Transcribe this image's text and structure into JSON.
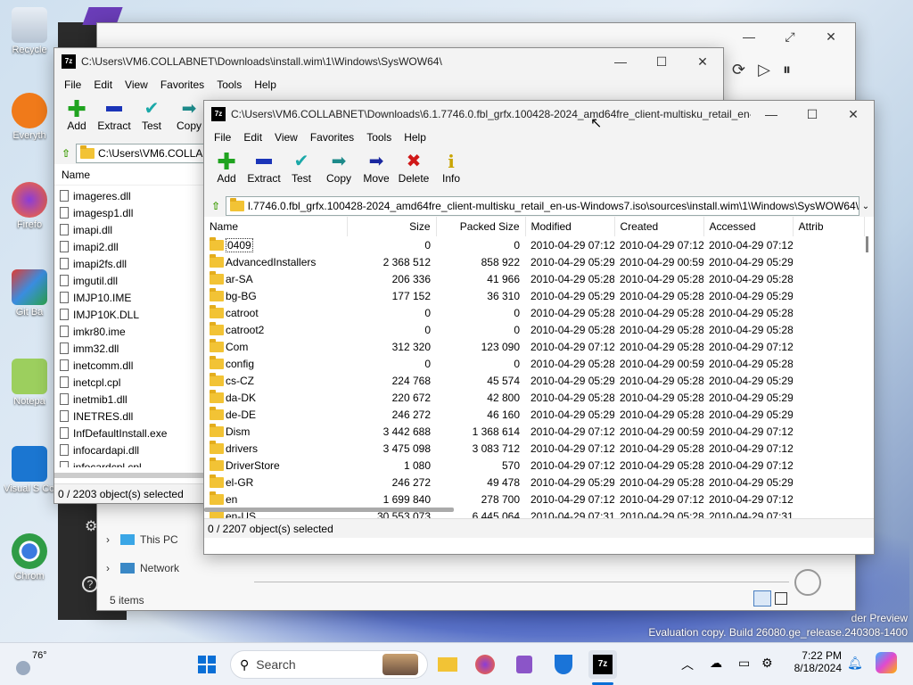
{
  "desktop": {
    "icons": [
      {
        "label": "Recycle"
      },
      {
        "label": "Everyth"
      },
      {
        "label": "Firefo"
      },
      {
        "label": "Git Ba"
      },
      {
        "label": "Notepa"
      },
      {
        "label": "Visual S Cod"
      },
      {
        "label": "Chrom"
      }
    ],
    "watermark_line1": "der Preview",
    "watermark_line2": "Evaluation copy. Build 26080.ge_release.240308-1400"
  },
  "explorer": {
    "nav": [
      {
        "label": "This PC"
      },
      {
        "label": "Network"
      }
    ],
    "status": "5 items"
  },
  "back_window": {
    "title": "C:\\Users\\VM6.COLLABNET\\Downloads\\install.wim\\1\\Windows\\SysWOW64\\",
    "menu": [
      "File",
      "Edit",
      "View",
      "Favorites",
      "Tools",
      "Help"
    ],
    "toolbar": [
      "Add",
      "Extract",
      "Test",
      "Copy"
    ],
    "address": "C:\\Users\\VM6.COLLA",
    "column_name": "Name",
    "files": [
      "imageres.dll",
      "imagesp1.dll",
      "imapi.dll",
      "imapi2.dll",
      "imapi2fs.dll",
      "imgutil.dll",
      "IMJP10.IME",
      "IMJP10K.DLL",
      "imkr80.ime",
      "imm32.dll",
      "inetcomm.dll",
      "inetcpl.cpl",
      "inetmib1.dll",
      "INETRES.dll",
      "InfDefaultInstall.exe",
      "infocardapi.dll",
      "infocardcpl.cpl"
    ],
    "status": "0 / 2203 object(s) selected"
  },
  "front_window": {
    "title": "C:\\Users\\VM6.COLLABNET\\Downloads\\6.1.7746.0.fbl_grfx.100428-2024_amd64fre_client-multisku_retail_en-u...",
    "menu": [
      "File",
      "Edit",
      "View",
      "Favorites",
      "Tools",
      "Help"
    ],
    "toolbar": [
      "Add",
      "Extract",
      "Test",
      "Copy",
      "Move",
      "Delete",
      "Info"
    ],
    "address": "l.7746.0.fbl_grfx.100428-2024_amd64fre_client-multisku_retail_en-us-Windows7.iso\\sources\\install.wim\\1\\Windows\\SysWOW64\\",
    "columns": [
      "Name",
      "Size",
      "Packed Size",
      "Modified",
      "Created",
      "Accessed",
      "Attrib"
    ],
    "rows": [
      [
        "0409",
        "0",
        "0",
        "2010-04-29 07:12",
        "2010-04-29 07:12",
        "2010-04-29 07:12"
      ],
      [
        "AdvancedInstallers",
        "2 368 512",
        "858 922",
        "2010-04-29 05:29",
        "2010-04-29 00:59",
        "2010-04-29 05:29"
      ],
      [
        "ar-SA",
        "206 336",
        "41 966",
        "2010-04-29 05:28",
        "2010-04-29 05:28",
        "2010-04-29 05:28"
      ],
      [
        "bg-BG",
        "177 152",
        "36 310",
        "2010-04-29 05:29",
        "2010-04-29 05:28",
        "2010-04-29 05:29"
      ],
      [
        "catroot",
        "0",
        "0",
        "2010-04-29 05:28",
        "2010-04-29 05:28",
        "2010-04-29 05:28"
      ],
      [
        "catroot2",
        "0",
        "0",
        "2010-04-29 05:28",
        "2010-04-29 05:28",
        "2010-04-29 05:28"
      ],
      [
        "Com",
        "312 320",
        "123 090",
        "2010-04-29 07:12",
        "2010-04-29 05:28",
        "2010-04-29 07:12"
      ],
      [
        "config",
        "0",
        "0",
        "2010-04-29 05:28",
        "2010-04-29 00:59",
        "2010-04-29 05:28"
      ],
      [
        "cs-CZ",
        "224 768",
        "45 574",
        "2010-04-29 05:29",
        "2010-04-29 05:28",
        "2010-04-29 05:29"
      ],
      [
        "da-DK",
        "220 672",
        "42 800",
        "2010-04-29 05:28",
        "2010-04-29 05:28",
        "2010-04-29 05:29"
      ],
      [
        "de-DE",
        "246 272",
        "46 160",
        "2010-04-29 05:29",
        "2010-04-29 05:28",
        "2010-04-29 05:29"
      ],
      [
        "Dism",
        "3 442 688",
        "1 368 614",
        "2010-04-29 07:12",
        "2010-04-29 00:59",
        "2010-04-29 07:12"
      ],
      [
        "drivers",
        "3 475 098",
        "3 083 712",
        "2010-04-29 07:12",
        "2010-04-29 05:28",
        "2010-04-29 07:12"
      ],
      [
        "DriverStore",
        "1 080",
        "570",
        "2010-04-29 07:12",
        "2010-04-29 05:28",
        "2010-04-29 07:12"
      ],
      [
        "el-GR",
        "246 272",
        "49 478",
        "2010-04-29 05:29",
        "2010-04-29 05:28",
        "2010-04-29 05:29"
      ],
      [
        "en",
        "1 699 840",
        "278 700",
        "2010-04-29 07:12",
        "2010-04-29 07:12",
        "2010-04-29 07:12"
      ],
      [
        "en-US",
        "30 553 073",
        "6 445 064",
        "2010-04-29 07:31",
        "2010-04-29 05:28",
        "2010-04-29 07:31"
      ]
    ],
    "status": "0 / 2207 object(s) selected"
  },
  "taskbar": {
    "weather": "76°",
    "search_placeholder": "Search",
    "time": "7:22 PM",
    "date": "8/18/2024",
    "sevenzip_label": "7z"
  }
}
